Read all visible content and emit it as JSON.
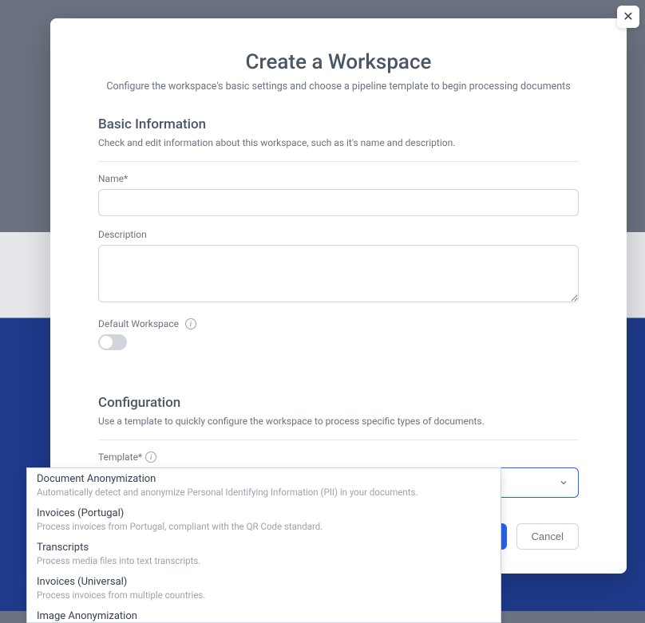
{
  "modal": {
    "title": "Create a Workspace",
    "subtitle": "Configure the workspace's basic settings and choose a pipeline template to begin processing documents"
  },
  "basic": {
    "heading": "Basic Information",
    "desc": "Check and edit information about this workspace, such as it's name and description.",
    "name_label": "Name*",
    "name_value": "",
    "description_label": "Description",
    "description_value": "",
    "default_ws_label": "Default Workspace"
  },
  "config": {
    "heading": "Configuration",
    "desc": "Use a template to quickly configure the workspace to process specific types of documents.",
    "template_label": "Template*",
    "options": [
      {
        "title": "Document Anonymization",
        "desc": "Automatically detect and anonymize Personal Identifying Information (PII) in your documents."
      },
      {
        "title": "Invoices (Portugal)",
        "desc": "Process invoices from Portugal, compliant with the QR Code standard."
      },
      {
        "title": "Transcripts",
        "desc": "Process media files into text transcripts."
      },
      {
        "title": "Invoices (Universal)",
        "desc": "Process invoices from multiple countries."
      },
      {
        "title": "Image Anonymization",
        "desc": ""
      }
    ]
  },
  "footer": {
    "cancel_label": "Cancel"
  }
}
